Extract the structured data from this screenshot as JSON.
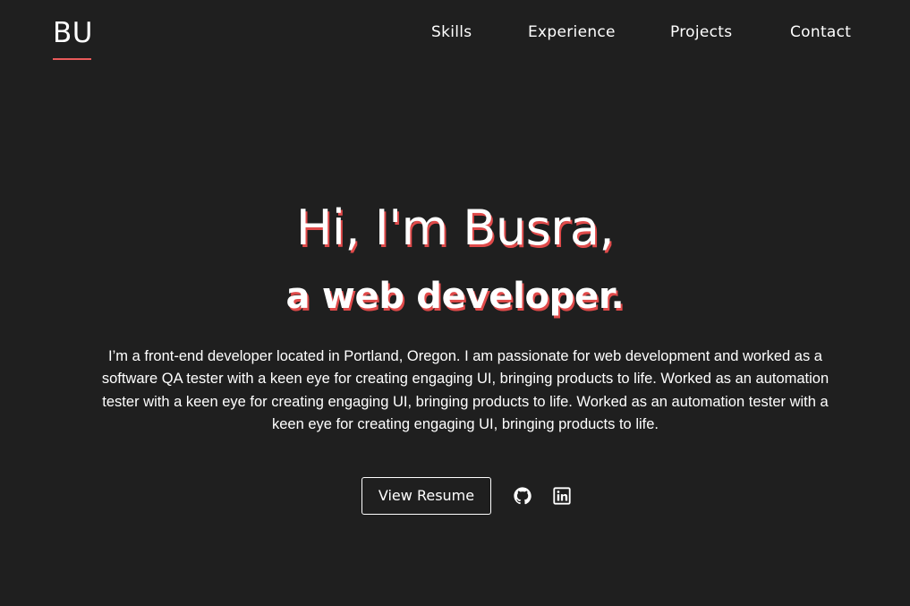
{
  "header": {
    "logo": "BU",
    "accent_color": "#e85a5a",
    "nav": [
      {
        "label": "Skills"
      },
      {
        "label": "Experience"
      },
      {
        "label": "Projects"
      },
      {
        "label": "Contact"
      }
    ]
  },
  "hero": {
    "greeting": "Hi, I'm Busra,",
    "role": "a web developer.",
    "intro": "I’m a front-end developer located in Portland, Oregon. I am passionate for web development and worked as a software QA tester with a keen eye for creating engaging UI, bringing products to life. Worked as an automation tester with a keen eye for creating engaging UI, bringing products to life. Worked as an automation tester with a keen eye for creating engaging UI, bringing products to life.",
    "resume_label": "View Resume",
    "social_icons": [
      "github-icon",
      "linkedin-icon"
    ]
  },
  "colors": {
    "background": "#1f1f1f",
    "text": "#ffffff",
    "shadow": "#e04a4a"
  }
}
